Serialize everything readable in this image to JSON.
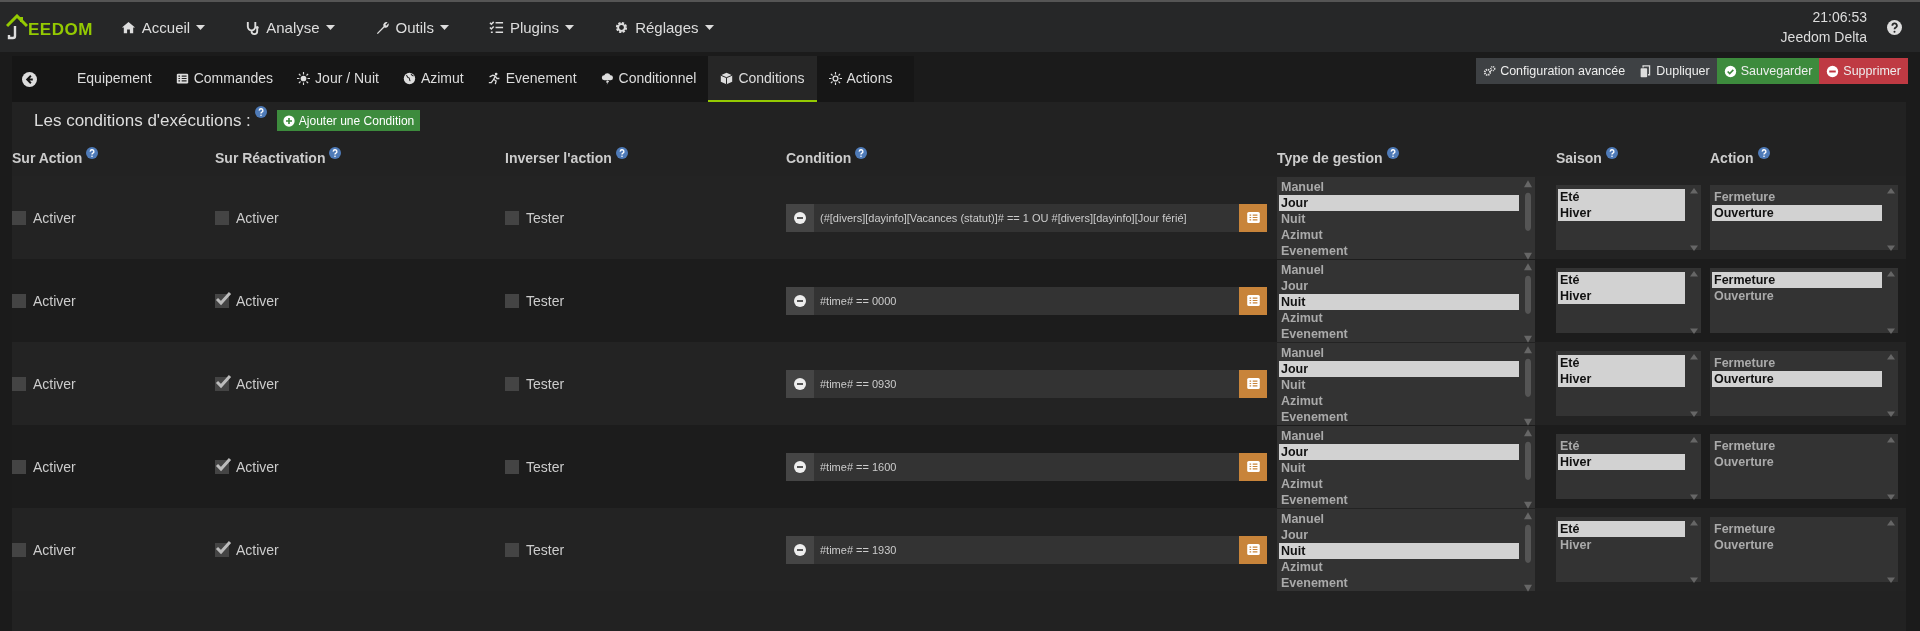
{
  "navbar": {
    "logo_text": "EEDOM",
    "menus": [
      {
        "label": "Accueil"
      },
      {
        "label": "Analyse"
      },
      {
        "label": "Outils"
      },
      {
        "label": "Plugins"
      },
      {
        "label": "Réglages"
      }
    ],
    "clock": "21:06:53",
    "user": "Jeedom Delta"
  },
  "tabs": [
    {
      "label": "Equipement",
      "selected": false
    },
    {
      "label": "Commandes",
      "selected": false
    },
    {
      "label": "Jour / Nuit",
      "selected": false
    },
    {
      "label": "Azimut",
      "selected": false
    },
    {
      "label": "Evenement",
      "selected": false
    },
    {
      "label": "Conditionnel",
      "selected": false
    },
    {
      "label": "Conditions",
      "selected": true
    },
    {
      "label": "Actions",
      "selected": false
    }
  ],
  "toolbar_buttons": [
    {
      "label": "Configuration avancée",
      "kind": "default"
    },
    {
      "label": "Dupliquer",
      "kind": "default"
    },
    {
      "label": "Sauvegarder",
      "kind": "success"
    },
    {
      "label": "Supprimer",
      "kind": "danger"
    }
  ],
  "section": {
    "title": "Les conditions d'exécutions :",
    "add_button": "Ajouter une Condition"
  },
  "table": {
    "columns": [
      "Sur Action",
      "Sur Réactivation",
      "Inverser l'action",
      "Condition",
      "Type de gestion",
      "Saison",
      "Action"
    ],
    "rows": [
      {
        "sur_action": {
          "label": "Activer",
          "checked": false
        },
        "sur_reactivation": {
          "label": "Activer",
          "checked": false
        },
        "inverser": {
          "label": "Tester",
          "checked": false
        },
        "condition": "(#[divers][dayinfo][Vacances (statut)]# == 1 OU #[divers][dayinfo][Jour férié]",
        "type_gestion": [
          {
            "label": "Manuel",
            "selected": false
          },
          {
            "label": "Jour",
            "selected": true
          },
          {
            "label": "Nuit",
            "selected": false
          },
          {
            "label": "Azimut",
            "selected": false
          },
          {
            "label": "Evenement",
            "selected": false
          }
        ],
        "saison": [
          {
            "label": "Eté",
            "selected": true
          },
          {
            "label": "Hiver",
            "selected": true
          }
        ],
        "action": [
          {
            "label": "Fermeture",
            "selected": false
          },
          {
            "label": "Ouverture",
            "selected": true
          }
        ]
      },
      {
        "sur_action": {
          "label": "Activer",
          "checked": false
        },
        "sur_reactivation": {
          "label": "Activer",
          "checked": true
        },
        "inverser": {
          "label": "Tester",
          "checked": false
        },
        "condition": "#time# == 0000",
        "type_gestion": [
          {
            "label": "Manuel",
            "selected": false
          },
          {
            "label": "Jour",
            "selected": false
          },
          {
            "label": "Nuit",
            "selected": true
          },
          {
            "label": "Azimut",
            "selected": false
          },
          {
            "label": "Evenement",
            "selected": false
          }
        ],
        "saison": [
          {
            "label": "Eté",
            "selected": true
          },
          {
            "label": "Hiver",
            "selected": true
          }
        ],
        "action": [
          {
            "label": "Fermeture",
            "selected": true
          },
          {
            "label": "Ouverture",
            "selected": false
          }
        ]
      },
      {
        "sur_action": {
          "label": "Activer",
          "checked": false
        },
        "sur_reactivation": {
          "label": "Activer",
          "checked": true
        },
        "inverser": {
          "label": "Tester",
          "checked": false
        },
        "condition": "#time# == 0930",
        "type_gestion": [
          {
            "label": "Manuel",
            "selected": false
          },
          {
            "label": "Jour",
            "selected": true
          },
          {
            "label": "Nuit",
            "selected": false
          },
          {
            "label": "Azimut",
            "selected": false
          },
          {
            "label": "Evenement",
            "selected": false
          }
        ],
        "saison": [
          {
            "label": "Eté",
            "selected": true
          },
          {
            "label": "Hiver",
            "selected": true
          }
        ],
        "action": [
          {
            "label": "Fermeture",
            "selected": false
          },
          {
            "label": "Ouverture",
            "selected": true
          }
        ]
      },
      {
        "sur_action": {
          "label": "Activer",
          "checked": false
        },
        "sur_reactivation": {
          "label": "Activer",
          "checked": true
        },
        "inverser": {
          "label": "Tester",
          "checked": false
        },
        "condition": "#time# == 1600",
        "type_gestion": [
          {
            "label": "Manuel",
            "selected": false
          },
          {
            "label": "Jour",
            "selected": true
          },
          {
            "label": "Nuit",
            "selected": false
          },
          {
            "label": "Azimut",
            "selected": false
          },
          {
            "label": "Evenement",
            "selected": false
          }
        ],
        "saison": [
          {
            "label": "Eté",
            "selected": false
          },
          {
            "label": "Hiver",
            "selected": true
          }
        ],
        "action": [
          {
            "label": "Fermeture",
            "selected": false
          },
          {
            "label": "Ouverture",
            "selected": false
          }
        ]
      },
      {
        "sur_action": {
          "label": "Activer",
          "checked": false
        },
        "sur_reactivation": {
          "label": "Activer",
          "checked": true
        },
        "inverser": {
          "label": "Tester",
          "checked": false
        },
        "condition": "#time# == 1930",
        "type_gestion": [
          {
            "label": "Manuel",
            "selected": false
          },
          {
            "label": "Jour",
            "selected": false
          },
          {
            "label": "Nuit",
            "selected": true
          },
          {
            "label": "Azimut",
            "selected": false
          },
          {
            "label": "Evenement",
            "selected": false
          }
        ],
        "saison": [
          {
            "label": "Eté",
            "selected": true
          },
          {
            "label": "Hiver",
            "selected": false
          }
        ],
        "action": [
          {
            "label": "Fermeture",
            "selected": false
          },
          {
            "label": "Ouverture",
            "selected": false
          }
        ]
      }
    ]
  }
}
